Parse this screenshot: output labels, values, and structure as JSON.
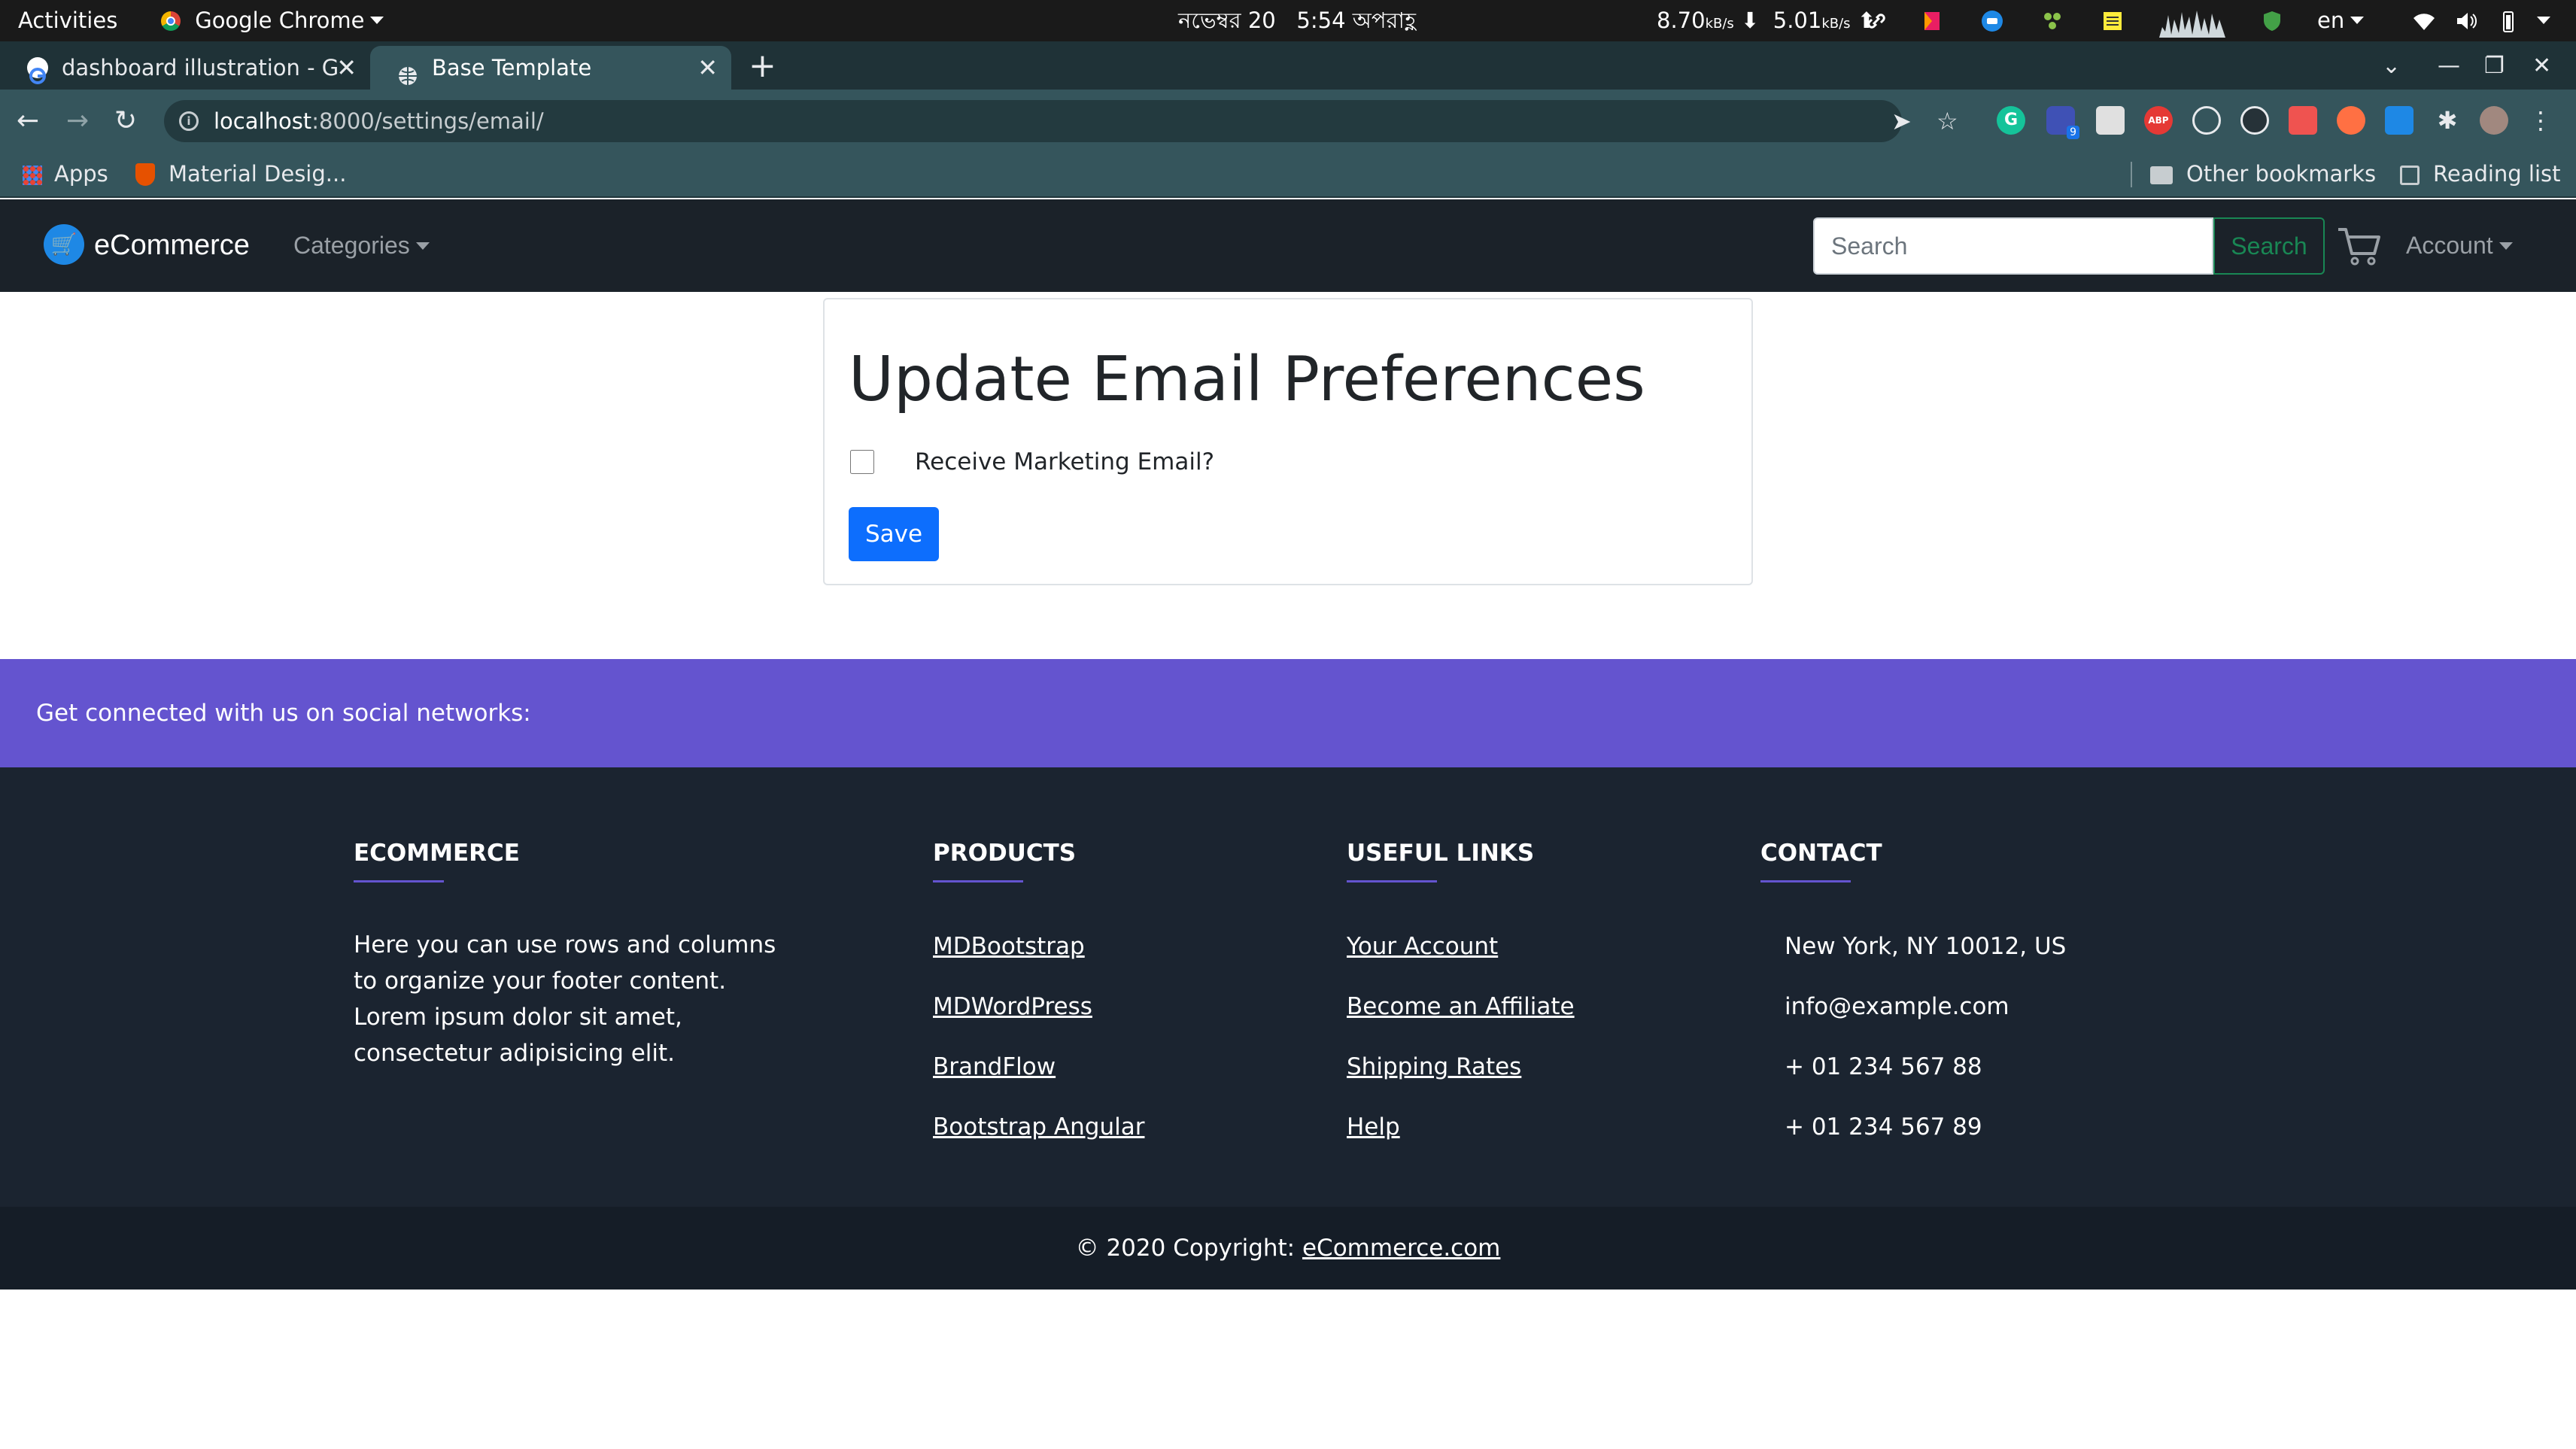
{
  "system_bar": {
    "activities": "Activities",
    "app_name": "Google Chrome",
    "date": "নভেম্বর 20",
    "time": "5:54 অপরাহ্ণ",
    "net_down": "8.70",
    "net_down_unit": "kB/s",
    "net_up": "5.01",
    "net_up_unit": "kB/s",
    "lang": "en"
  },
  "tabs": [
    {
      "title": "dashboard illustration - G",
      "active": false
    },
    {
      "title": "Base Template",
      "active": true
    }
  ],
  "omnibox": {
    "host": "localhost",
    "path": ":8000/settings/email/"
  },
  "extensions": {
    "badge_count": "9",
    "abp_label": "ABP"
  },
  "bookmarks": {
    "apps": "Apps",
    "material": "Material Desig...",
    "other": "Other bookmarks",
    "reading_list": "Reading list"
  },
  "navbar": {
    "brand": "eCommerce",
    "categories": "Categories",
    "search_placeholder": "Search",
    "search_button": "Search",
    "account": "Account"
  },
  "form": {
    "title": "Update Email Preferences",
    "checkbox_label": "Receive Marketing Email?",
    "checkbox_checked": false,
    "save_label": "Save",
    "accent_color": "#0d6efd"
  },
  "social": {
    "text": "Get connected with us on social networks:",
    "color": "#6454cf"
  },
  "footer": {
    "about": {
      "heading": "ECOMMERCE",
      "text": "Here you can use rows and columns to organize your footer content. Lorem ipsum dolor sit amet, consectetur adipisicing elit."
    },
    "products": {
      "heading": "PRODUCTS",
      "links": [
        "MDBootstrap",
        "MDWordPress",
        "BrandFlow",
        "Bootstrap Angular"
      ]
    },
    "useful_links": {
      "heading": "USEFUL LINKS",
      "links": [
        "Your Account",
        "Become an Affiliate",
        "Shipping Rates",
        "Help"
      ]
    },
    "contact": {
      "heading": "CONTACT",
      "items": [
        "New York, NY 10012, US",
        "info@example.com",
        "+ 01 234 567 88",
        "+ 01 234 567 89"
      ]
    },
    "copyright_prefix": "© 2020 Copyright: ",
    "copyright_link": "eCommerce.com"
  }
}
